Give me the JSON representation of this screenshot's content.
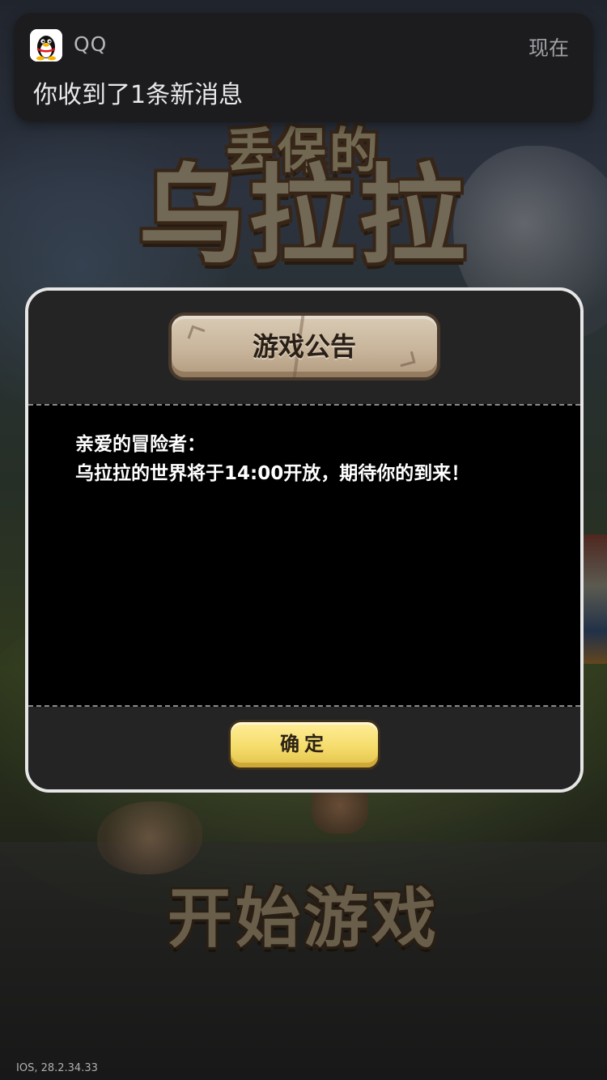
{
  "notification": {
    "app_name": "QQ",
    "time": "现在",
    "message": "你收到了1条新消息",
    "icon": "qq-penguin-icon"
  },
  "game": {
    "title_sub": "丢保的",
    "title_main": "乌拉拉",
    "start_button": "开始游戏",
    "version": "IOS, 28.2.34.33"
  },
  "dialog": {
    "title": "游戏公告",
    "greeting": "亲爱的冒险者：",
    "message": "乌拉拉的世界将于14:00开放，期待你的到来！",
    "confirm_label": "确定"
  },
  "colors": {
    "dialog_bg": "#000000",
    "dialog_border": "#e6e6e6",
    "confirm_button": "#f5dc6b",
    "plaque": "#c8b59b"
  }
}
